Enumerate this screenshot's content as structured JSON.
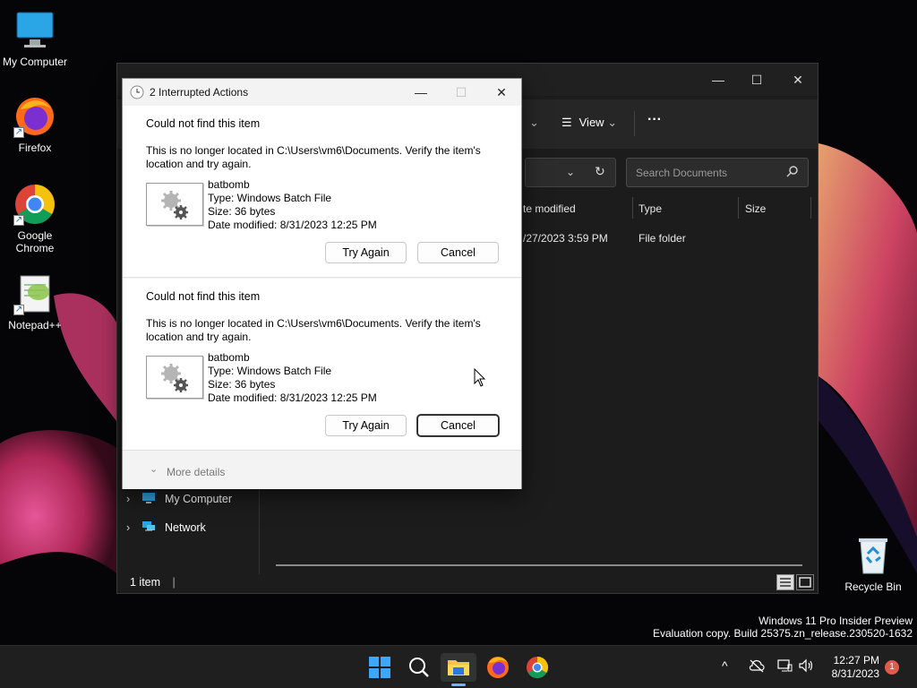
{
  "desktop": {
    "icons": [
      {
        "label": "My Computer",
        "icon": "monitor-icon"
      },
      {
        "label": "Firefox",
        "icon": "firefox-icon"
      },
      {
        "label": "Google Chrome",
        "icon": "chrome-icon"
      },
      {
        "label": "Notepad++",
        "icon": "notepadpp-icon"
      },
      {
        "label": "Recycle Bin",
        "icon": "recycle-bin-icon"
      }
    ],
    "watermark": {
      "line1": "Windows 11 Pro Insider Preview",
      "line2": "Evaluation copy. Build 25375.zn_release.230520-1632"
    }
  },
  "explorer": {
    "toolbar": {
      "view_label": "View",
      "more_label": "···"
    },
    "search_placeholder": "Search Documents",
    "columns": [
      "te modified",
      "Type",
      "Size"
    ],
    "row": {
      "date": "/27/2023 3:59 PM",
      "type": "File folder"
    },
    "nav": [
      {
        "label": "My Computer"
      },
      {
        "label": "Network"
      }
    ],
    "status": "1 item"
  },
  "dialog": {
    "title": "2 Interrupted Actions",
    "items": [
      {
        "heading": "Could not find this item",
        "message": "This is no longer located in C:\\Users\\vm6\\Documents. Verify the item's location and try again.",
        "name": "batbomb",
        "type": "Type: Windows Batch File",
        "size": "Size: 36 bytes",
        "modified": "Date modified: 8/31/2023 12:25 PM",
        "try_again": "Try Again",
        "cancel": "Cancel"
      },
      {
        "heading": "Could not find this item",
        "message": "This is no longer located in C:\\Users\\vm6\\Documents. Verify the item's location and try again.",
        "name": "batbomb",
        "type": "Type: Windows Batch File",
        "size": "Size: 36 bytes",
        "modified": "Date modified: 8/31/2023 12:25 PM",
        "try_again": "Try Again",
        "cancel": "Cancel"
      }
    ],
    "more_details": "More details"
  },
  "taskbar": {
    "apps": [
      "start-icon",
      "search-icon",
      "file-explorer-icon",
      "firefox-icon",
      "chrome-icon"
    ],
    "time": "12:27 PM",
    "date": "8/31/2023",
    "notifications": "1"
  }
}
